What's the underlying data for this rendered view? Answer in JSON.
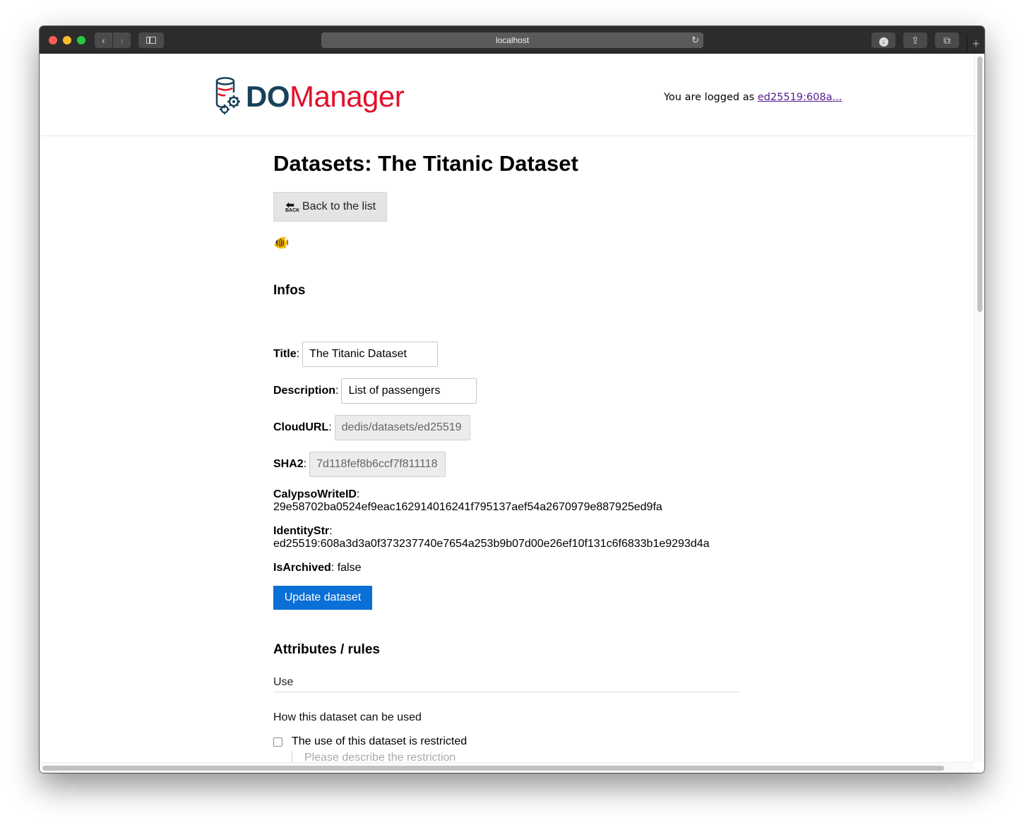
{
  "browser": {
    "url": "localhost",
    "back_glyph": "‹",
    "forward_glyph": "›",
    "reload_glyph": "↻",
    "download_glyph": "↓",
    "share_glyph": "⇪",
    "tabs_glyph": "⧉",
    "new_tab_glyph": "+"
  },
  "header": {
    "logo_do": "DO",
    "logo_manager": "Manager",
    "login_prefix": "You are logged as ",
    "login_user": "ed25519:608a..."
  },
  "page": {
    "title": "Datasets: The Titanic Dataset",
    "back_button": "Back to the list",
    "back_icon_text": "BACK",
    "fish_icon": "🐠"
  },
  "infos": {
    "heading": "Infos",
    "title_label": "Title",
    "title_value": "The Titanic Dataset",
    "description_label": "Description",
    "description_value": "List of passengers",
    "cloudurl_label": "CloudURL",
    "cloudurl_value": "dedis/datasets/ed25519",
    "sha2_label": "SHA2",
    "sha2_value": "7d118fef8b6ccf7f811118",
    "calypso_label": "CalypsoWriteID",
    "calypso_value": "29e58702ba0524ef9eac162914016241f795137aef54a2670979e887925ed9fa",
    "identity_label": "IdentityStr",
    "identity_value": "ed25519:608a3d3a0f373237740e7654a253b9b07d00e26ef10f131c6f6833b1e9293d4a",
    "archived_label": "IsArchived",
    "archived_value": "false",
    "update_button": "Update dataset"
  },
  "attributes": {
    "heading": "Attributes / rules",
    "tab_label": "Use",
    "description": "How this dataset can be used",
    "restricted_label": "The use of this dataset is restricted",
    "restricted_checked": false,
    "restriction_placeholder": "Please describe the restriction"
  },
  "colors": {
    "brand_dark": "#17425a",
    "brand_red": "#e3102a",
    "primary_button": "#0a6fd6"
  }
}
